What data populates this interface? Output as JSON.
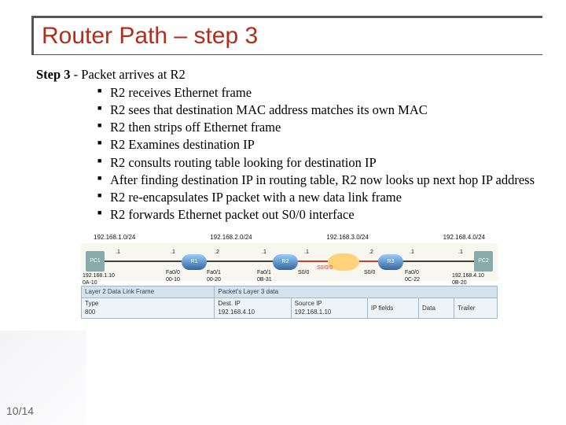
{
  "title": "Router Path – step 3",
  "step_label": "Step 3",
  "step_suffix": " - Packet arrives at R2",
  "bullets": [
    "R2 receives Ethernet frame",
    "R2 sees that destination MAC address matches its own MAC",
    "R2 then strips off Ethernet frame",
    "R2 Examines destination IP",
    "R2 consults routing table looking for destination IP",
    "After finding destination IP in routing table, R2 now looks up next hop IP address",
    "R2 re-encapsulates IP packet with a new data link frame",
    "R2 forwards Ethernet packet out S0/0 interface"
  ],
  "page_num": "10/14",
  "subnets": [
    "192.168.1.0/24",
    "192.168.2.0/24",
    "192.168.3.0/24",
    "192.168.4.0/24"
  ],
  "nodes": {
    "pc1": "PC1",
    "r1": "R1",
    "r2": "R2",
    "r3": "R3",
    "pc2": "PC2"
  },
  "iface": {
    "pc1_addr": "192.168.1.10\n0A-10",
    "r1_fa00": "Fa0/0\n00-10",
    "r1_fa01": "Fa0/1\n00-20",
    "r2_fa01": "Fa0/1\n0B-31",
    "r2_s00": "S0/0",
    "r3_s00": "S0/0",
    "r3_fa00": "Fa0/0\n0C-22",
    "pc2_addr": "192.168.4.10\n0B-20",
    "dot1_l": ".1",
    "dot1_r": ".1",
    "dot2_l": ".2",
    "dot2_r": ".2",
    "s000": "S0/0/0"
  },
  "frame": {
    "l2_caption": "Layer 2 Data Link Frame",
    "l3_caption": "Packet's Layer 3 data",
    "type_h": "Type",
    "type_v": "800",
    "dest_h": "Dest. IP",
    "dest_v": "192.168.4.10",
    "src_h": "Source IP",
    "src_v": "192.168.1.10",
    "ipf": "IP fields",
    "data": "Data",
    "trailer": "Trailer"
  }
}
